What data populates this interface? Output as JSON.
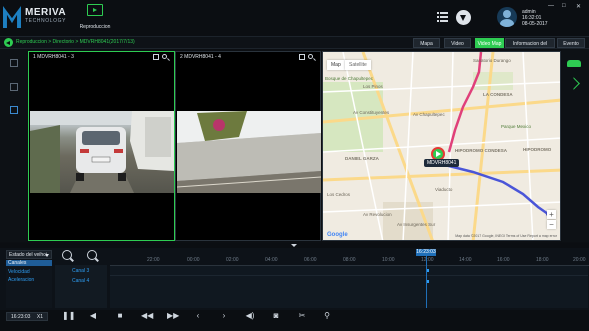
{
  "app": {
    "brand": "MERIVA",
    "tagline": "TECHNOLOGY",
    "module_label": "Reproduccion"
  },
  "user": {
    "name": "admin",
    "time": "16:32:01",
    "date": "08-05-2017"
  },
  "window_controls": [
    "—",
    "□",
    "✕"
  ],
  "breadcrumb": "Reproduccion > Directorio > MDVRH8041(2017/7/13)",
  "tabs": [
    {
      "label": "Mapa",
      "active": false
    },
    {
      "label": "Video",
      "active": false
    },
    {
      "label": "Video Map",
      "active": true
    },
    {
      "label": "Informacion del cuadro",
      "active": false
    },
    {
      "label": "Evento",
      "active": false
    }
  ],
  "videos": [
    {
      "title": "1 MDVRH8041 - 3"
    },
    {
      "title": "2 MDVRH8041 - 4"
    }
  ],
  "map": {
    "types": [
      "Map",
      "Satellite"
    ],
    "labels": [
      "Sanatorio Durango",
      "Los Pinos",
      "LA CONDESA",
      "HIPODROMO CONDESA",
      "DANIEL GARZA",
      "Av Constituyentes",
      "Av Chapultepec",
      "Viaducto",
      "HIPODROMO",
      "Los Cedros",
      "Bosque de Chapultepec",
      "Av Insurgentes Sur",
      "Parque Mexico",
      "Av Revolucion"
    ],
    "vehicle_label": "MDVRH8041",
    "google_label": "Google",
    "footer": "Map data ©2017 Google, INEGI   Terms of Use   Report a map error",
    "zoom_in": "+",
    "zoom_out": "−"
  },
  "state_select": {
    "value": "Estado del veihci"
  },
  "left_list": [
    {
      "label": "Canales",
      "selected": true
    },
    {
      "label": "Velocidad",
      "selected": false
    },
    {
      "label": "Aceleracion",
      "selected": false
    }
  ],
  "channels": [
    "Canal 3",
    "Canal 4"
  ],
  "timeline": {
    "cursor_time": "16:23:03",
    "ticks": [
      "22:00",
      "00:00",
      "02:00",
      "04:00",
      "06:00",
      "08:00",
      "10:00",
      "12:00",
      "14:00",
      "16:00",
      "18:00",
      "20:00"
    ]
  },
  "playback": {
    "time": "16:23:03",
    "speed": "X1",
    "buttons": [
      "pause",
      "rewind",
      "stop",
      "fast-backward",
      "fast-forward",
      "prev-frame",
      "next-frame",
      "volume",
      "snapshot",
      "clip",
      "mark"
    ]
  },
  "colors": {
    "accent": "#2ecc52",
    "highlight": "#1f6fb8",
    "route_red": "#e0407a",
    "route_blue": "#4a55d8"
  }
}
